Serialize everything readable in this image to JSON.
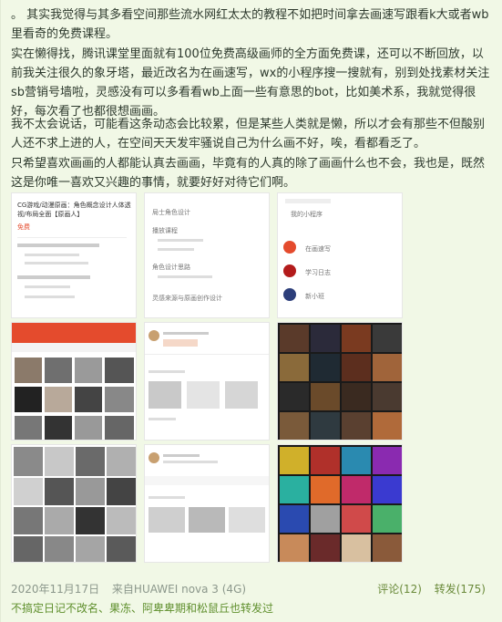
{
  "post": {
    "p1": "。 其实我觉得与其多看空间那些流水网红太太的教程不如把时间拿去画速写跟看k大或者wb里看奇的免费课程。",
    "p2": "实在懒得找，腾讯课堂里面就有100位免费高级画师的全方面免费课，还可以不断回放，以前我关注很久的象牙塔，最近改名为在画速写，wx的小程序搜一搜就有，别到处找素材关注sb营销号墙啦，灵感没有可以多看看wb上面一些有意思的bot，比如美术系，我就觉得很好，每次看了也都很想画画。",
    "p3": "我不太会说话，可能看这条动态会比较累，但是某些人类就是懒，所以才会有那些不但酸别人还不求上进的人，在空间天天发牢骚说自己为什么画不好，唉，看都看乏了。",
    "p4": "只希望喜欢画画的人都能认真去画画，毕竟有的人真的除了画画什么也不会，我也是，既然这是你唯一喜欢又兴趣的事情，就要好好对待它们啊。"
  },
  "thumbs": {
    "t1_title": "CG游戏/动漫原画：角色概念设计人体透视/布局全面【原画人】",
    "t1_sub": "免费",
    "t2_items": [
      "局士角色设计",
      "播放课程",
      "角色设计思路",
      "灵感来源与原画创作设计"
    ],
    "t3_items": [
      "我的小程序",
      "在画速写",
      "学习日志",
      "新小班"
    ]
  },
  "meta": {
    "date": "2020年11月17日",
    "device": "来自HUAWEI nova 3 (4G)",
    "comments": "评论(12)",
    "reposts": "转发(175)",
    "reposters": "不搞定日记不改名、果冻、阿卑卑期和松鼠丘也转发过"
  }
}
